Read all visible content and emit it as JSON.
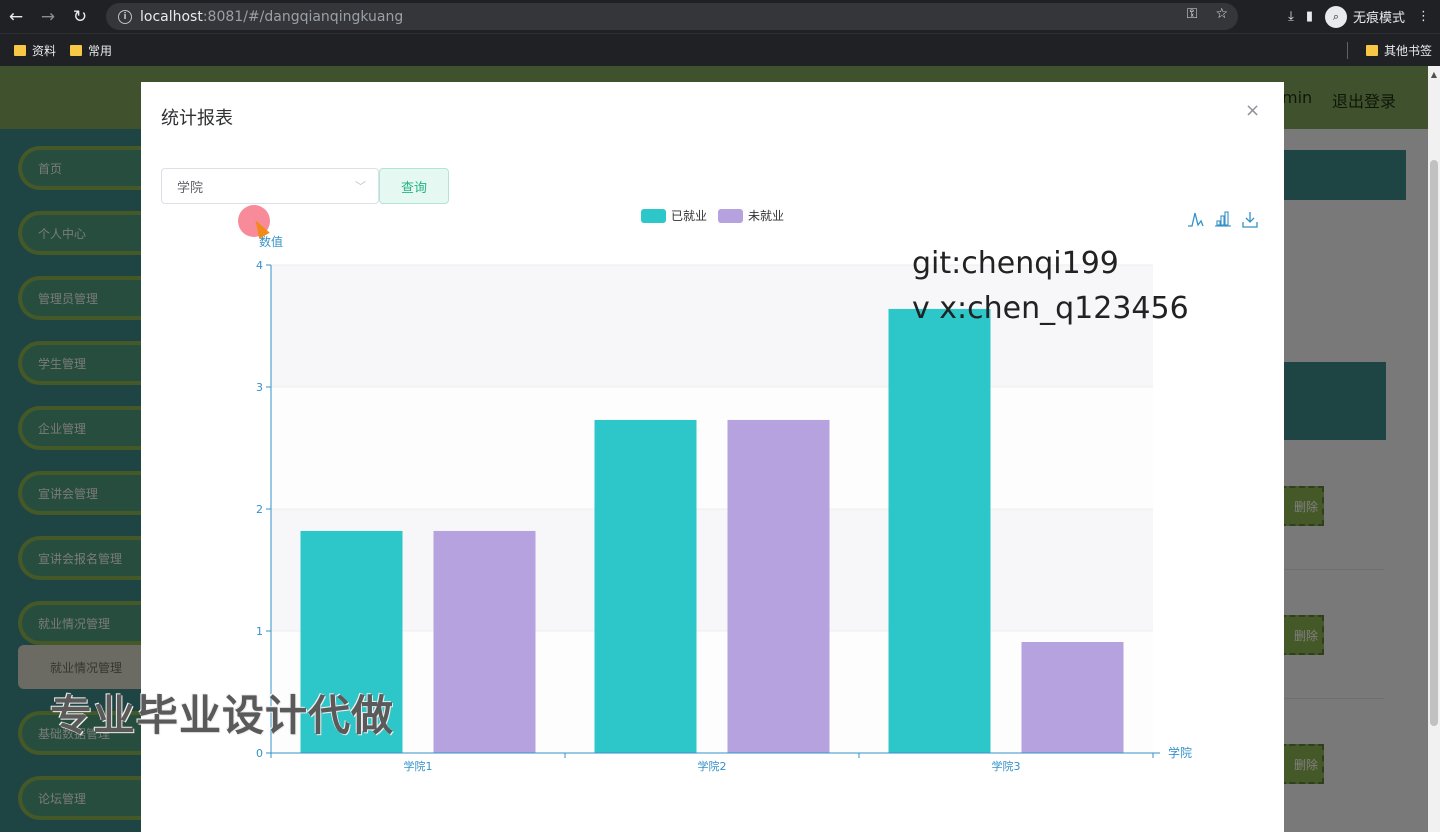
{
  "browser": {
    "url_host": "localhost",
    "url_path": ":8081/#/dangqianqingkuang",
    "profile_label": "无痕模式",
    "bookmarks": [
      "资料",
      "常用"
    ],
    "other_bookmarks": "其他书签"
  },
  "app": {
    "user_fragment": "min",
    "logout_label": "退出登录",
    "menu": [
      "首页",
      "个人中心",
      "管理员管理",
      "学生管理",
      "企业管理",
      "宣讲会管理",
      "宣讲会报名管理",
      "就业情况管理",
      "就业情况管理",
      "基础数据管理",
      "论坛管理"
    ],
    "delete_label": "删除"
  },
  "dialog": {
    "title": "统计报表",
    "close_icon": "×",
    "select_value": "学院",
    "query_label": "查询"
  },
  "watermarks": {
    "line1": "git:chenqi199",
    "line2": "v x:chen_q123456",
    "banner": "专业毕业设计代做"
  },
  "colors": {
    "header": "#7fa55a",
    "sidebar": "#3d8a86",
    "series1": "#2ec7c9",
    "series2": "#b6a2de",
    "axis": "#3592c8"
  },
  "chart_data": {
    "type": "bar",
    "categories": [
      "学院1",
      "学院2",
      "学院3"
    ],
    "series": [
      {
        "name": "已就业",
        "values": [
          1.82,
          2.73,
          3.64
        ]
      },
      {
        "name": "未就业",
        "values": [
          1.82,
          2.73,
          0.91
        ]
      }
    ],
    "xlabel": "学院",
    "ylabel": "数值",
    "ylim": [
      0,
      4
    ],
    "yticks": [
      0,
      1,
      2,
      3,
      4
    ],
    "legend_position": "top-center",
    "grid": true,
    "toolbox_icons": [
      "line-chart-icon",
      "bar-chart-icon",
      "download-icon"
    ]
  }
}
